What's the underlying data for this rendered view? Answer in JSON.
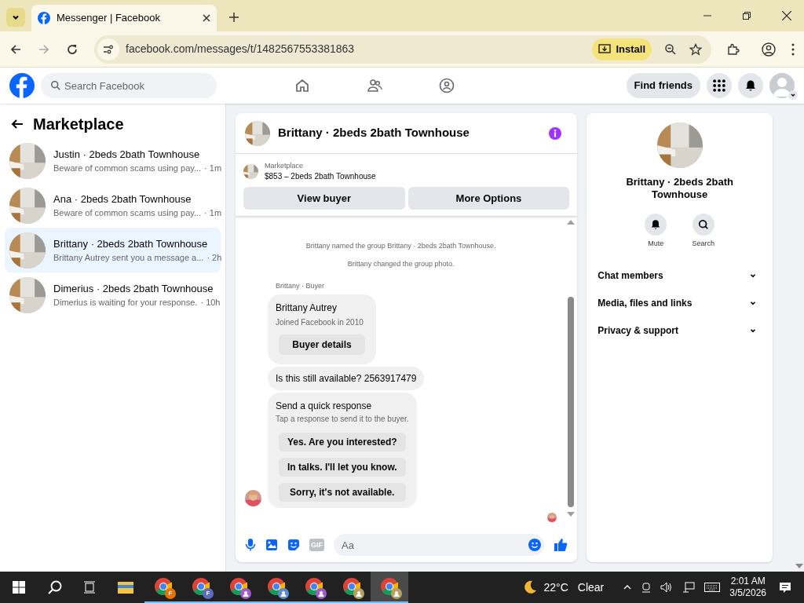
{
  "browser": {
    "tab_title": "Messenger | Facebook",
    "url": "facebook.com/messages/t/1482567553381863",
    "install_label": "Install"
  },
  "header": {
    "search_placeholder": "Search Facebook",
    "find_friends": "Find friends"
  },
  "sidebar": {
    "title": "Marketplace",
    "conversations": [
      {
        "name": "Justin · 2beds 2bath Townhouse",
        "preview": "Beware of common scams using pay...",
        "time": "· 1m",
        "selected": false
      },
      {
        "name": "Ana · 2beds 2bath Townhouse",
        "preview": "Beware of common scams using pay...",
        "time": "· 1m",
        "selected": false
      },
      {
        "name": "Brittany · 2beds 2bath Townhouse",
        "preview": "Brittany Autrey sent you a message a...",
        "time": "· 2h",
        "selected": true
      },
      {
        "name": "Dimerius · 2beds 2bath Townhouse",
        "preview": "Dimerius is waiting for your response.",
        "time": "· 10h",
        "selected": false
      }
    ]
  },
  "chat": {
    "title": "Brittany · 2beds 2bath Townhouse",
    "listing": {
      "source": "Marketplace",
      "item": "$853 – 2beds 2bath Townhouse"
    },
    "buttons": [
      "View buyer",
      "More Options"
    ],
    "events": [
      "Brittany named the group Brittany · 2beds 2bath Townhouse.",
      "Brittany changed the group photo."
    ],
    "sender_label": "Brittany · Buyer",
    "buyer_card": {
      "name": "Brittany Autrey",
      "joined": "Joined Facebook in 2010",
      "button": "Buyer details"
    },
    "message": "Is this still available? 2563917479",
    "quick_response": {
      "title": "Send a quick response",
      "subtitle": "Tap a response to send it to the buyer.",
      "options": [
        "Yes. Are you interested?",
        "In talks. I'll let you know.",
        "Sorry, it's not available."
      ]
    },
    "gif_label": "GIF",
    "composer_placeholder": "Aa"
  },
  "details": {
    "title": "Brittany · 2beds 2bath Townhouse",
    "actions": [
      {
        "kind": "mute",
        "label": "Mute"
      },
      {
        "kind": "search",
        "label": "Search"
      }
    ],
    "sections": [
      "Chat members",
      "Media, files and links",
      "Privacy & support"
    ]
  },
  "taskbar": {
    "apps": [
      {
        "kind": "explorer",
        "selected": false
      },
      {
        "kind": "chrome",
        "badge": "F",
        "color": "#e8710a",
        "selected": false
      },
      {
        "kind": "chrome",
        "badge": "F",
        "color": "#5b6bc0",
        "selected": false
      },
      {
        "kind": "chrome",
        "color": "#a05cc8",
        "selected": false
      },
      {
        "kind": "chrome",
        "color": "#5b8bd0",
        "selected": false
      },
      {
        "kind": "chrome",
        "color": "#a05cc8",
        "selected": false
      },
      {
        "kind": "chrome",
        "color": "#b8a060",
        "selected": false
      },
      {
        "kind": "chrome",
        "color": "#b8a060",
        "selected": true
      }
    ],
    "temperature": "22°C",
    "weather": "Clear",
    "time": "2:01 AM",
    "date": "3/5/2026"
  }
}
